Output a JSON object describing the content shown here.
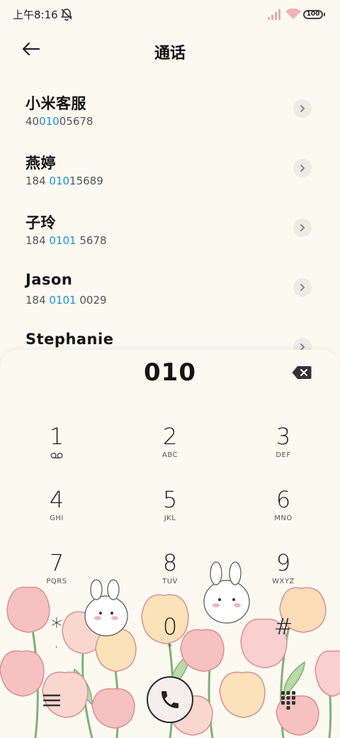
{
  "status": {
    "time": "上午8:16",
    "battery": "100",
    "icons": [
      "bell-muted-icon",
      "signal-icon",
      "wifi-icon",
      "battery-icon"
    ]
  },
  "header": {
    "title": "通话",
    "back_icon": "arrow-left-icon"
  },
  "contacts": [
    {
      "name": "小米客服",
      "number_pre": "40",
      "number_hl": "010",
      "number_post": "05678"
    },
    {
      "name": "燕婷",
      "number_pre": "184 ",
      "number_hl": "010",
      "number_post": "15689"
    },
    {
      "name": "子玲",
      "number_pre": "184 ",
      "number_hl": "0101",
      "number_post": " 5678"
    },
    {
      "name": "Jason",
      "number_pre": "184 ",
      "number_hl": "0101",
      "number_post": " 0029"
    },
    {
      "name": "Stephanie",
      "number_pre": "",
      "number_hl": "",
      "number_post": ""
    }
  ],
  "dialer": {
    "input": "010",
    "keys": [
      {
        "digit": "1",
        "sub": ""
      },
      {
        "digit": "2",
        "sub": "ABC"
      },
      {
        "digit": "3",
        "sub": "DEF"
      },
      {
        "digit": "4",
        "sub": "GHI"
      },
      {
        "digit": "5",
        "sub": "JKL"
      },
      {
        "digit": "6",
        "sub": "MNO"
      },
      {
        "digit": "7",
        "sub": "PQRS"
      },
      {
        "digit": "8",
        "sub": "TUV"
      },
      {
        "digit": "9",
        "sub": "WXYZ"
      },
      {
        "digit": "*",
        "sub": ","
      },
      {
        "digit": "0",
        "sub": "+"
      },
      {
        "digit": "#",
        "sub": ""
      }
    ]
  },
  "colors": {
    "background": "#fcf9f1",
    "highlight": "#1a93d9",
    "tulip": "#f6c1c0"
  }
}
